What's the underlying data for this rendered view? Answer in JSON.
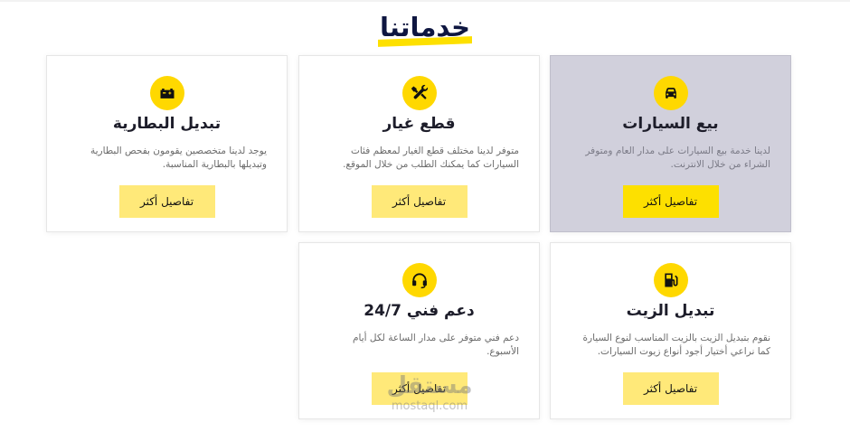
{
  "section": {
    "title": "خدماتنا"
  },
  "cards": [
    {
      "icon": "car-icon",
      "title": "بيع السيارات",
      "desc": "لدينا خدمة بيع السيارات على مدار العام ومتوفر الشراء من خلال الانترنت.",
      "button": "تفاصيل أكثر"
    },
    {
      "icon": "tools-icon",
      "title": "قطع غيار",
      "desc": "متوفر لدينا مختلف قطع الغيار لمعظم فئات السيارات كما يمكنك الطلب من خلال الموقع.",
      "button": "تفاصيل أكثر"
    },
    {
      "icon": "battery-icon",
      "title": "تبديل البطارية",
      "desc": "يوجد لدينا متخصصين يقومون بفحص البطارية وتبديلها بالبطارية المناسبة.",
      "button": "تفاصيل أكثر"
    },
    {
      "icon": "gas-pump-icon",
      "title": "تبديل الزيت",
      "desc": "نقوم بتبديل الزيت بالزيت المناسب لنوع السيارة كما نراعي أختيار أجود أنواع زيوت السيارات.",
      "button": "تفاصيل أكثر"
    },
    {
      "icon": "headset-icon",
      "title": "دعم فني 24/7",
      "desc": "دعم فني متوفر على مدار الساعة لكل أيام الأسبوع.",
      "button": "تفاصيل أكثر"
    }
  ],
  "watermark": {
    "line1": "مستقل",
    "line2": "mostaql.com"
  },
  "colors": {
    "accent": "#ffd800",
    "button": "#ffe979",
    "active_card": "#d1d0dc",
    "title": "#0e1640"
  }
}
